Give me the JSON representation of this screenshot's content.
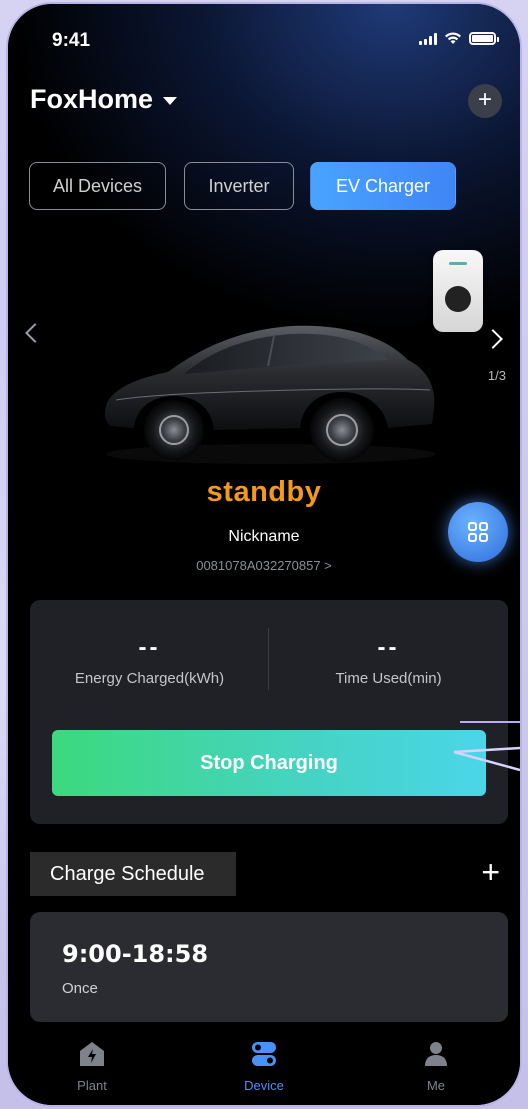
{
  "status_bar": {
    "time": "9:41"
  },
  "header": {
    "home_name": "FoxHome",
    "add_label": "+"
  },
  "tabs": [
    {
      "label": "All Devices",
      "active": false
    },
    {
      "label": "Inverter",
      "active": false
    },
    {
      "label": "EV Charger",
      "active": true
    }
  ],
  "carousel": {
    "pager": "1/3"
  },
  "device": {
    "status": "standby",
    "nickname": "Nickname",
    "serial": "0081078A032270857 >"
  },
  "stats": {
    "energy_value": "--",
    "energy_label": "Energy Charged(kWh)",
    "time_value": "--",
    "time_label": "Time Used(min)"
  },
  "stop_button": {
    "label": "Stop Charging"
  },
  "schedule": {
    "title": "Charge Schedule",
    "add_label": "+",
    "items": [
      {
        "time": "9:00-18:58",
        "repeat": "Once"
      }
    ]
  },
  "nav": {
    "items": [
      {
        "label": "Plant",
        "icon": "plant-icon",
        "active": false
      },
      {
        "label": "Device",
        "icon": "device-icon",
        "active": true
      },
      {
        "label": "Me",
        "icon": "user-icon",
        "active": false
      }
    ]
  },
  "colors": {
    "accent_blue": "#4a90f5",
    "status_orange": "#f39a1e",
    "stop_green": "#3cd97d",
    "stop_cyan": "#4ad6e8"
  }
}
